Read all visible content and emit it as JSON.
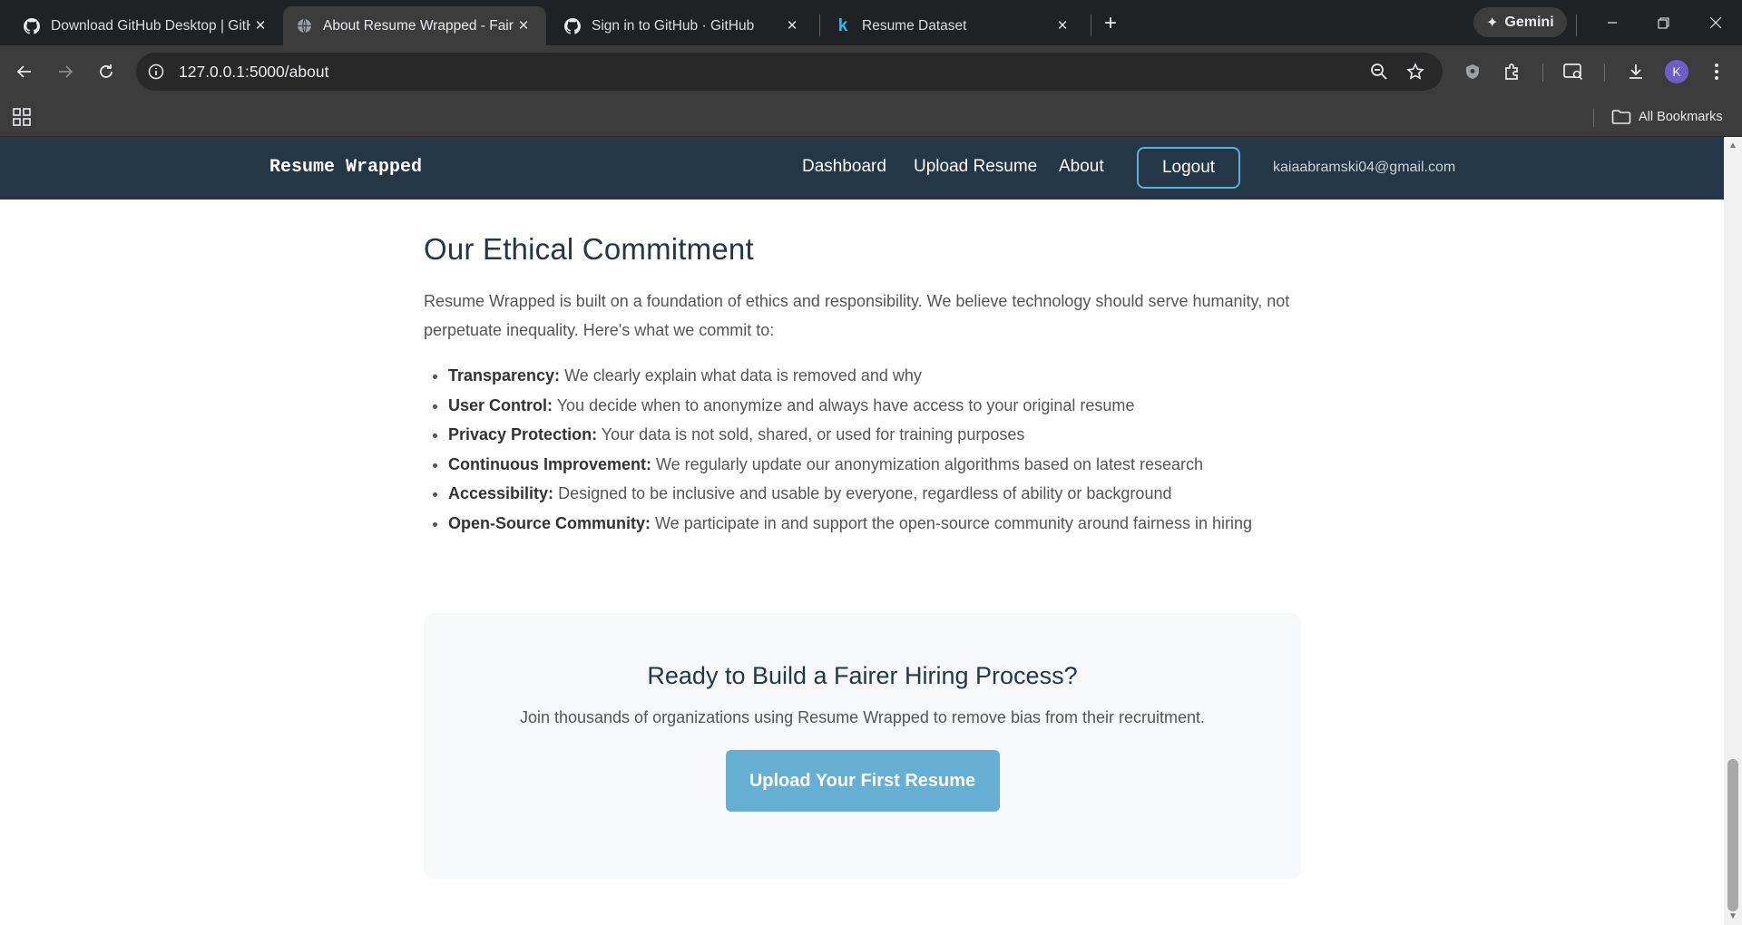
{
  "browser": {
    "tabs": [
      {
        "title": "Download GitHub Desktop | GitHub",
        "favicon": "github-icon",
        "active": false
      },
      {
        "title": "About Resume Wrapped - Fair Hiring",
        "favicon": "globe-icon",
        "active": true
      },
      {
        "title": "Sign in to GitHub · GitHub",
        "favicon": "github-icon",
        "active": false
      },
      {
        "title": "Resume Dataset",
        "favicon": "kaggle-icon",
        "active": false
      }
    ],
    "gemini_label": "Gemini",
    "url": "127.0.0.1:5000/about",
    "profile_initial": "K",
    "bookmarks_label": "All Bookmarks"
  },
  "site_nav": {
    "brand": "Resume Wrapped",
    "links": [
      "Dashboard",
      "Upload Resume",
      "About"
    ],
    "logout_label": "Logout",
    "user_email": "kaiaabramski04@gmail.com"
  },
  "ethics": {
    "heading": "Our Ethical Commitment",
    "intro": "Resume Wrapped is built on a foundation of ethics and responsibility. We believe technology should serve humanity, not perpetuate inequality. Here's what we commit to:",
    "items": [
      {
        "label": "Transparency:",
        "text": " We clearly explain what data is removed and why"
      },
      {
        "label": "User Control:",
        "text": " You decide when to anonymize and always have access to your original resume"
      },
      {
        "label": "Privacy Protection:",
        "text": " Your data is not sold, shared, or used for training purposes"
      },
      {
        "label": "Continuous Improvement:",
        "text": " We regularly update our anonymization algorithms based on latest research"
      },
      {
        "label": "Accessibility:",
        "text": " Designed to be inclusive and usable by everyone, regardless of ability or background"
      },
      {
        "label": "Open-Source Community:",
        "text": " We participate in and support the open-source community around fairness in hiring"
      }
    ]
  },
  "cta": {
    "title": "Ready to Build a Fairer Hiring Process?",
    "subtitle": "Join thousands of organizations using Resume Wrapped to remove bias from their recruitment.",
    "button_label": "Upload Your First Resume"
  },
  "colors": {
    "nav_bg": "#233746",
    "accent": "#64afd2",
    "cta_bg": "#f7f8fa"
  }
}
